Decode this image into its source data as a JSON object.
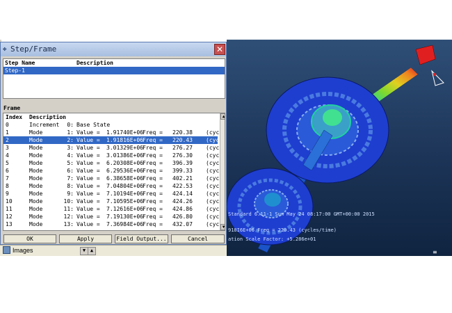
{
  "dialog": {
    "title": "Step/Frame",
    "close_glyph": "✕",
    "steps_header": {
      "name": "Step Name",
      "description": "Description"
    },
    "steps": [
      {
        "name": "Step-1",
        "description": ""
      }
    ],
    "frame_label": "Frame",
    "frames_header": {
      "index": "Index",
      "description": "Description"
    },
    "frames": [
      {
        "index": "0",
        "type": "Increment",
        "num": "0:",
        "value_label": "Base State",
        "value": "",
        "freq_label": "",
        "freq": "",
        "unit": ""
      },
      {
        "index": "1",
        "type": "Mode",
        "num": "1:",
        "value_label": "Value =",
        "value": "1.91740E+06",
        "freq_label": "Freq =",
        "freq": "220.38",
        "unit": "(cyc"
      },
      {
        "index": "2",
        "type": "Mode",
        "num": "2:",
        "value_label": "Value =",
        "value": "1.91816E+06",
        "freq_label": "Freq =",
        "freq": "220.43",
        "unit": "(cyc"
      },
      {
        "index": "3",
        "type": "Mode",
        "num": "3:",
        "value_label": "Value =",
        "value": "3.01329E+06",
        "freq_label": "Freq =",
        "freq": "276.27",
        "unit": "(cyc"
      },
      {
        "index": "4",
        "type": "Mode",
        "num": "4:",
        "value_label": "Value =",
        "value": "3.01386E+06",
        "freq_label": "Freq =",
        "freq": "276.30",
        "unit": "(cyc"
      },
      {
        "index": "5",
        "type": "Mode",
        "num": "5:",
        "value_label": "Value =",
        "value": "6.20308E+06",
        "freq_label": "Freq =",
        "freq": "396.39",
        "unit": "(cyc"
      },
      {
        "index": "6",
        "type": "Mode",
        "num": "6:",
        "value_label": "Value =",
        "value": "6.29536E+06",
        "freq_label": "Freq =",
        "freq": "399.33",
        "unit": "(cyc"
      },
      {
        "index": "7",
        "type": "Mode",
        "num": "7:",
        "value_label": "Value =",
        "value": "6.38658E+06",
        "freq_label": "Freq =",
        "freq": "402.21",
        "unit": "(cyc"
      },
      {
        "index": "8",
        "type": "Mode",
        "num": "8:",
        "value_label": "Value =",
        "value": "7.04804E+06",
        "freq_label": "Freq =",
        "freq": "422.53",
        "unit": "(cyc"
      },
      {
        "index": "9",
        "type": "Mode",
        "num": "9:",
        "value_label": "Value =",
        "value": "7.10194E+06",
        "freq_label": "Freq =",
        "freq": "424.14",
        "unit": "(cyc"
      },
      {
        "index": "10",
        "type": "Mode",
        "num": "10:",
        "value_label": "Value =",
        "value": "7.10595E+06",
        "freq_label": "Freq =",
        "freq": "424.26",
        "unit": "(cyc"
      },
      {
        "index": "11",
        "type": "Mode",
        "num": "11:",
        "value_label": "Value =",
        "value": "7.12616E+06",
        "freq_label": "Freq =",
        "freq": "424.86",
        "unit": "(cyc"
      },
      {
        "index": "12",
        "type": "Mode",
        "num": "12:",
        "value_label": "Value =",
        "value": "7.19130E+06",
        "freq_label": "Freq =",
        "freq": "426.80",
        "unit": "(cyc"
      },
      {
        "index": "13",
        "type": "Mode",
        "num": "13:",
        "value_label": "Value =",
        "value": "7.36984E+06",
        "freq_label": "Freq =",
        "freq": "432.07",
        "unit": "(cyc"
      }
    ],
    "selected_frame_index": 2,
    "buttons": {
      "ok": "OK",
      "apply": "Apply",
      "field_output": "Field Output...",
      "cancel": "Cancel"
    }
  },
  "tree": {
    "item": "Images",
    "icon": "images-icon"
  },
  "viewport": {
    "info_line1": "Standard 6.11-1   Sun May 24 08:17:00 GMT+00:00 2015",
    "info_line2": "918I6E+06 Freq =    220.43    (cycles/time)",
    "info_line3": "ation Scale Factor: +5.286e+01"
  },
  "colors": {
    "selection": "#3168c5",
    "titlebar": "#a8bfe0",
    "viewport_bg": "#1c3457",
    "close": "#c85050"
  }
}
